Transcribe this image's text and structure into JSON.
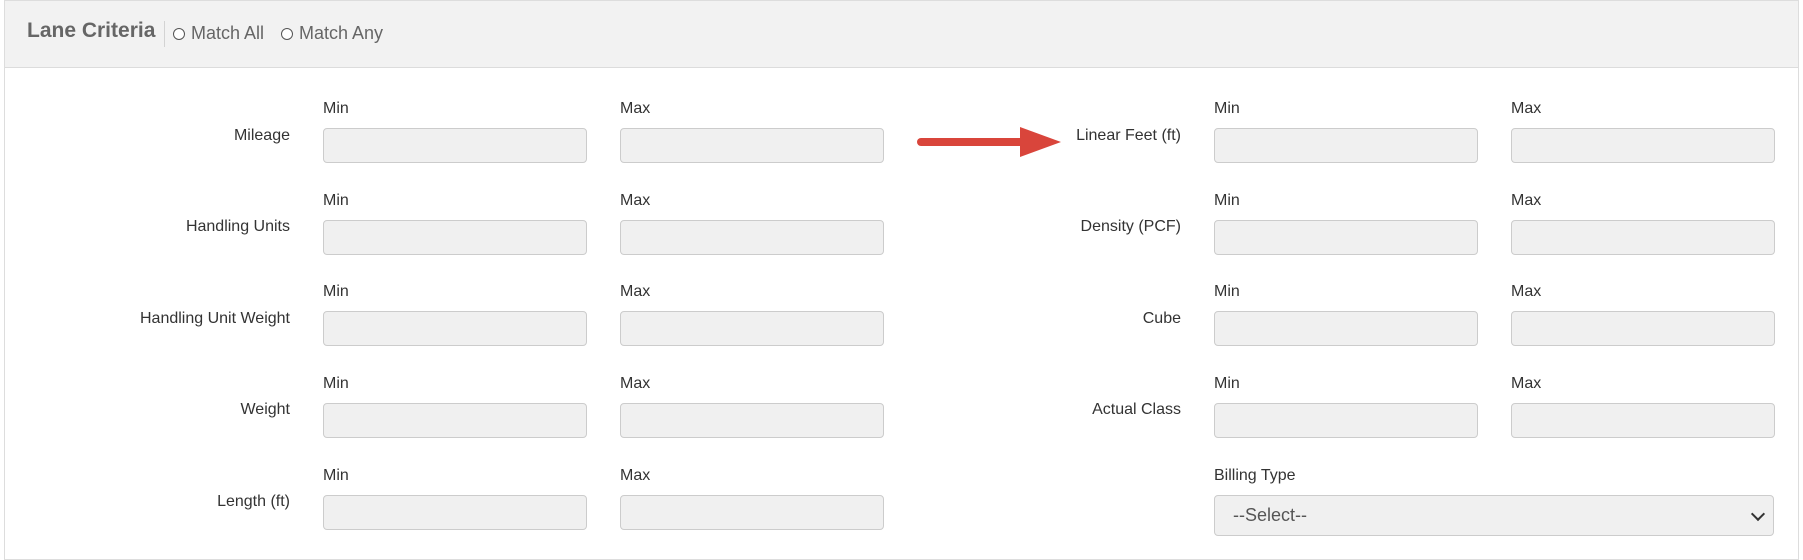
{
  "header": {
    "title": "Lane Criteria",
    "match_all_label": "Match All",
    "match_any_label": "Match Any"
  },
  "fields": {
    "min_label": "Min",
    "max_label": "Max",
    "mileage": "Mileage",
    "handling_units": "Handling Units",
    "handling_unit_weight": "Handling Unit Weight",
    "weight": "Weight",
    "length": "Length (ft)",
    "linear_feet": "Linear Feet (ft)",
    "density": "Density (PCF)",
    "cube": "Cube",
    "actual_class": "Actual Class",
    "billing_type_label": "Billing Type",
    "billing_type_value": "--Select--"
  },
  "colors": {
    "header_bg": "#f2f2f2",
    "input_bg": "#f0f0f0",
    "arrow": "#d9453b"
  },
  "icons": {
    "annotation": "red-arrow-right",
    "select": "chevron-down"
  }
}
